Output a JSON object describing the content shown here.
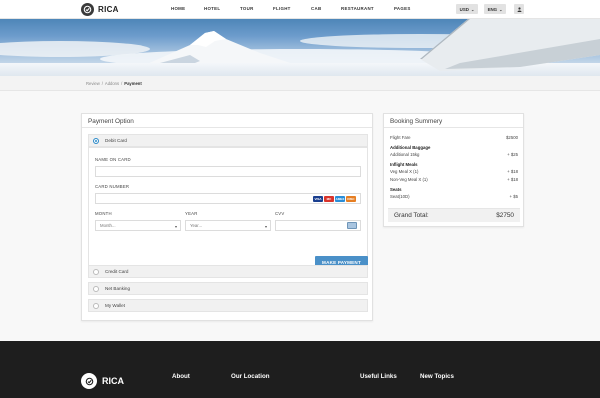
{
  "header": {
    "brand": "RICA",
    "nav": [
      "HOME",
      "HOTEL",
      "TOUR",
      "FLIGHT",
      "CAB",
      "RESTAURANT",
      "PAGES"
    ],
    "currency": "USD",
    "language": "ENG"
  },
  "breadcrumb": [
    "Review",
    "Addons",
    "Payment"
  ],
  "payment": {
    "title": "Payment Option",
    "debit_label": "Debit Card",
    "name_label": "NAME ON CARD",
    "number_label": "CARD NUMBER",
    "month_label": "MONTH",
    "year_label": "YEAR",
    "cvv_label": "CVV",
    "month_placeholder": "Month...",
    "year_placeholder": "Year...",
    "card_brands": [
      "VISA",
      "MC",
      "AMEX",
      "DISC"
    ],
    "button": "MAKE PAYMENT",
    "credit_label": "Credit Card",
    "netbanking_label": "Net Banking",
    "wallet_label": "My Wallet"
  },
  "booking": {
    "title": "Booking Summery",
    "flight_fare_label": "Flight Fare",
    "flight_fare_value": "$2500",
    "baggage_heading": "Additional Baggage",
    "baggage_label": "Additional 15kg",
    "baggage_value": "+ $25",
    "meals_heading": "Inflight Meals",
    "veg_label": "Veg Meal X (1)",
    "veg_value": "+ $18",
    "nonveg_label": "Non-Veg Meal X (1)",
    "nonveg_value": "+ $18",
    "seats_heading": "Seats",
    "seat_label": "Seat(10D)",
    "seat_value": "+ $5",
    "total_label": "Grand Total:",
    "total_value": "$2750"
  },
  "footer": {
    "brand": "RICA",
    "headings": [
      "About",
      "Our Location",
      "Useful Links",
      "New Topics"
    ]
  },
  "colors": {
    "accent": "#4a90c8",
    "footer_bg": "#1e1e1e"
  }
}
